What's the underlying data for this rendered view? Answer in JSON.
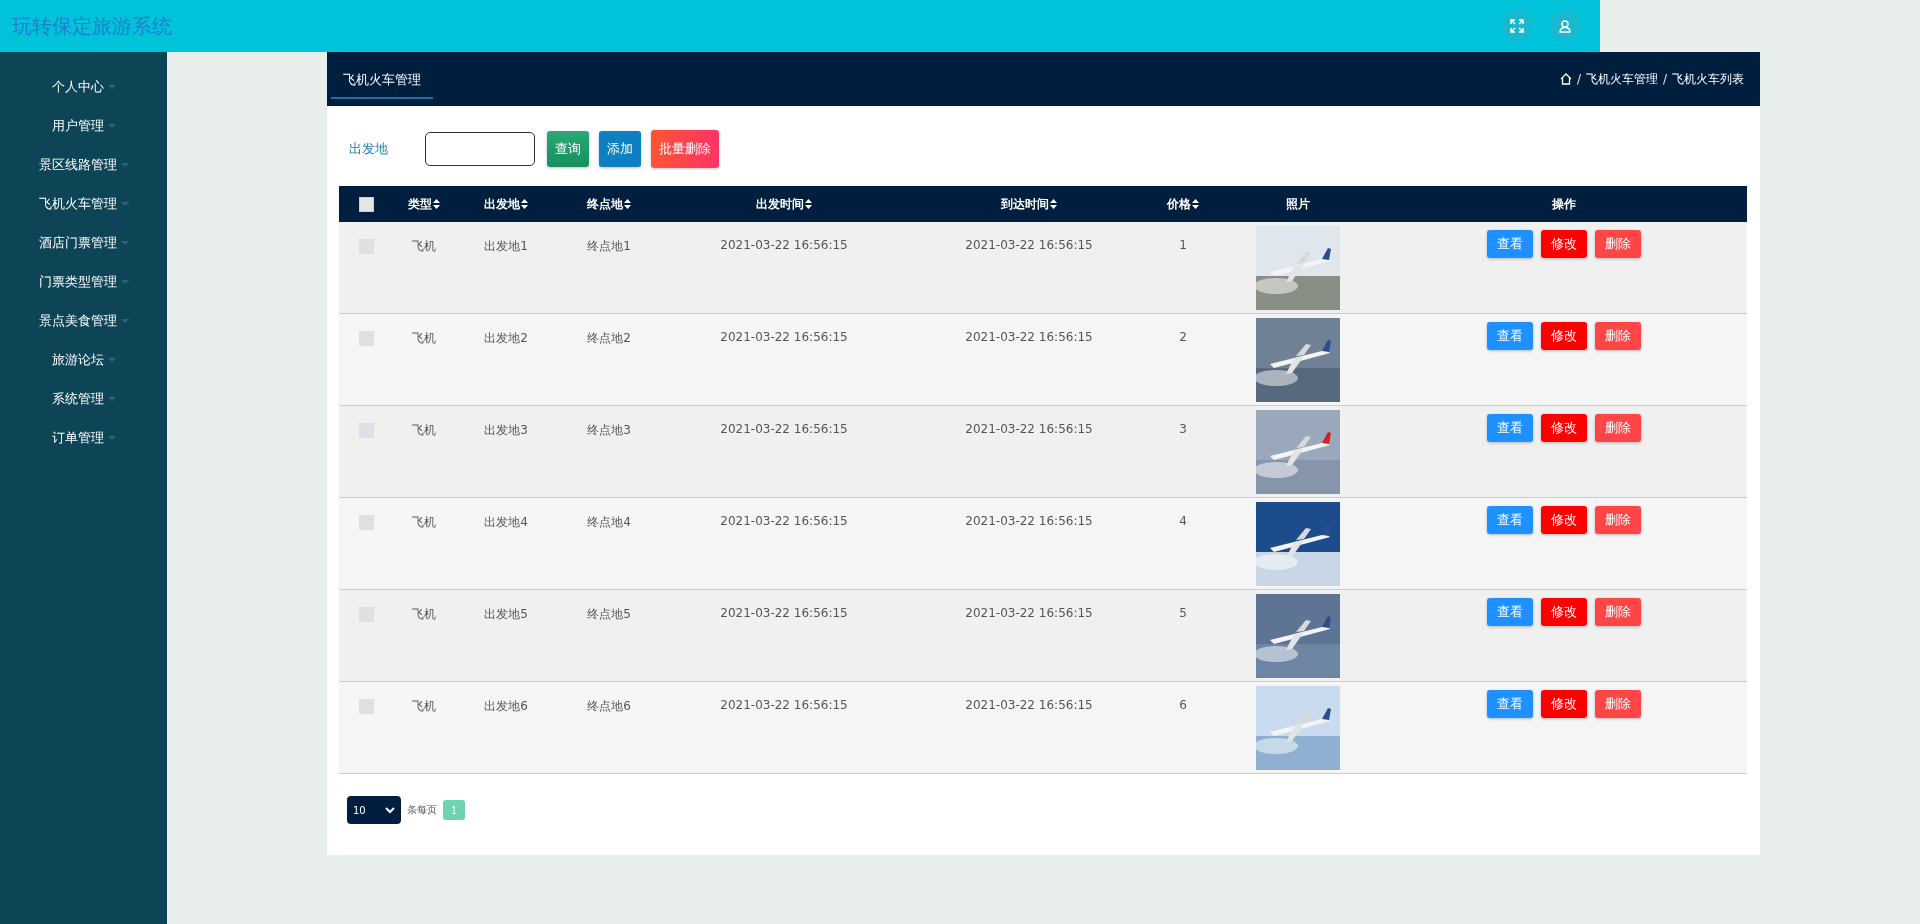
{
  "app_title": "玩转保定旅游系统",
  "sidebar": {
    "items": [
      {
        "label": "个人中心",
        "expanded": false
      },
      {
        "label": "用户管理",
        "expanded": false
      },
      {
        "label": "景区线路管理",
        "expanded": false
      },
      {
        "label": "飞机火车管理",
        "expanded": false
      },
      {
        "label": "酒店门票管理",
        "expanded": false
      },
      {
        "label": "门票类型管理",
        "expanded": false
      },
      {
        "label": "景点美食管理",
        "expanded": false
      },
      {
        "label": "旅游论坛",
        "expanded": false
      },
      {
        "label": "系统管理",
        "expanded": false
      },
      {
        "label": "订单管理",
        "expanded": false
      }
    ]
  },
  "panel": {
    "tab": "飞机火车管理",
    "breadcrumb": [
      {
        "kind": "separator",
        "text": "/"
      },
      {
        "kind": "link",
        "text": "飞机火车管理"
      },
      {
        "kind": "separator",
        "text": "/"
      },
      {
        "kind": "link",
        "text": "飞机火车列表"
      }
    ]
  },
  "search": {
    "label": "出发地",
    "buttons": [
      {
        "label": "查询",
        "kind": "query"
      },
      {
        "label": "添加",
        "kind": "add"
      },
      {
        "label": "批量删除",
        "kind": "delete"
      }
    ]
  },
  "table": {
    "select_all": {
      "checked": false
    },
    "columns": [
      {
        "label": "类型",
        "sortable": true
      },
      {
        "label": "出发地",
        "sortable": true
      },
      {
        "label": "终点地",
        "sortable": true
      },
      {
        "label": "出发时间",
        "sortable": true
      },
      {
        "label": "到达时间",
        "sortable": true
      },
      {
        "label": "价格",
        "sortable": true
      },
      {
        "label": "照片",
        "sortable": false
      },
      {
        "label": "操作",
        "sortable": false
      }
    ],
    "rows": [
      {
        "checked": false,
        "cells": [
          "飞机",
          "出发地1",
          "终点地1",
          "2021-03-22 16:56:15",
          "2021-03-22 16:56:15",
          "1"
        ],
        "photo": {
          "kind": "picture"
        },
        "actions": [
          {
            "label": "查看",
            "kind": "view"
          },
          {
            "label": "修改",
            "kind": "edit"
          },
          {
            "label": "删除",
            "kind": "delete"
          }
        ]
      },
      {
        "checked": false,
        "cells": [
          "飞机",
          "出发地2",
          "终点地2",
          "2021-03-22 16:56:15",
          "2021-03-22 16:56:15",
          "2"
        ],
        "photo": {
          "kind": "picture"
        },
        "actions": [
          {
            "label": "查看",
            "kind": "view"
          },
          {
            "label": "修改",
            "kind": "edit"
          },
          {
            "label": "删除",
            "kind": "delete"
          }
        ]
      },
      {
        "checked": false,
        "cells": [
          "飞机",
          "出发地3",
          "终点地3",
          "2021-03-22 16:56:15",
          "2021-03-22 16:56:15",
          "3"
        ],
        "photo": {
          "kind": "picture"
        },
        "actions": [
          {
            "label": "查看",
            "kind": "view"
          },
          {
            "label": "修改",
            "kind": "edit"
          },
          {
            "label": "删除",
            "kind": "delete"
          }
        ]
      },
      {
        "checked": false,
        "cells": [
          "飞机",
          "出发地4",
          "终点地4",
          "2021-03-22 16:56:15",
          "2021-03-22 16:56:15",
          "4"
        ],
        "photo": {
          "kind": "picture"
        },
        "actions": [
          {
            "label": "查看",
            "kind": "view"
          },
          {
            "label": "修改",
            "kind": "edit"
          },
          {
            "label": "删除",
            "kind": "delete"
          }
        ]
      },
      {
        "checked": false,
        "cells": [
          "飞机",
          "出发地5",
          "终点地5",
          "2021-03-22 16:56:15",
          "2021-03-22 16:56:15",
          "5"
        ],
        "photo": {
          "kind": "picture"
        },
        "actions": [
          {
            "label": "查看",
            "kind": "view"
          },
          {
            "label": "修改",
            "kind": "edit"
          },
          {
            "label": "删除",
            "kind": "delete"
          }
        ]
      },
      {
        "checked": false,
        "cells": [
          "飞机",
          "出发地6",
          "终点地6",
          "2021-03-22 16:56:15",
          "2021-03-22 16:56:15",
          "6"
        ],
        "photo": {
          "kind": "picture"
        },
        "actions": [
          {
            "label": "查看",
            "kind": "view"
          },
          {
            "label": "修改",
            "kind": "edit"
          },
          {
            "label": "删除",
            "kind": "delete"
          }
        ]
      }
    ]
  },
  "pagination": {
    "page_size": "10",
    "per_page_label": "条每页",
    "pages": [
      {
        "label": "1",
        "selected": true
      }
    ]
  }
}
